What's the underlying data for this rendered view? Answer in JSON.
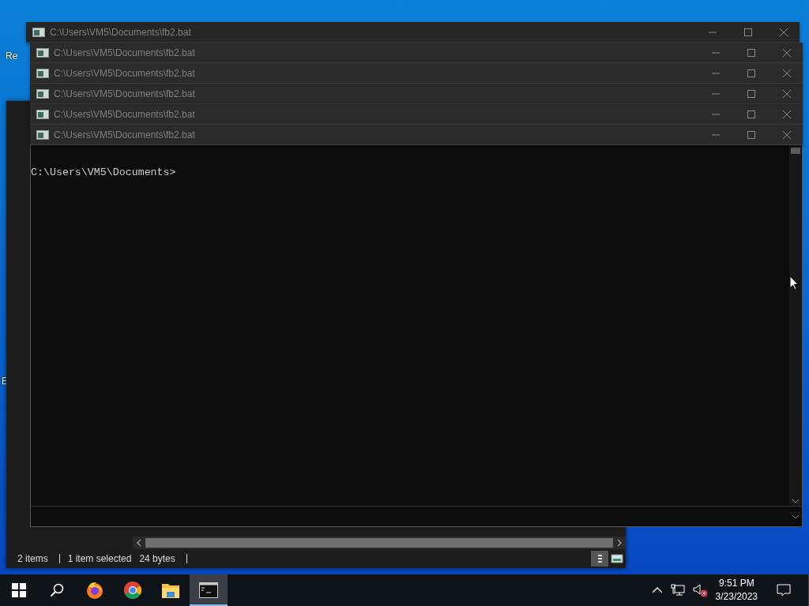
{
  "desktop": {
    "icon_labels": [
      "Re",
      "E"
    ]
  },
  "explorer": {
    "status_bar": [
      "2 items",
      "1 item selected",
      "24 bytes"
    ]
  },
  "console_windows": [
    {
      "title": "C:\\Users\\VM5\\Documents\\fb2.bat"
    },
    {
      "title": "C:\\Users\\VM5\\Documents\\fb2.bat"
    },
    {
      "title": "C:\\Users\\VM5\\Documents\\fb2.bat"
    },
    {
      "title": "C:\\Users\\VM5\\Documents\\fb2.bat"
    },
    {
      "title": "C:\\Users\\VM5\\Documents\\fb2.bat"
    },
    {
      "title": "C:\\Users\\VM5\\Documents\\fb2.bat"
    }
  ],
  "console": {
    "lines": [
      "C:\\Users\\VM5\\Documents>"
    ]
  },
  "taskbar": {
    "apps": [
      {
        "kind": "start",
        "selected": false
      },
      {
        "kind": "search",
        "selected": false
      },
      {
        "kind": "firefox",
        "selected": false
      },
      {
        "kind": "chrome",
        "selected": false
      },
      {
        "kind": "files",
        "selected": false
      },
      {
        "kind": "terminal",
        "selected": true
      }
    ],
    "tray": {
      "volume_muted": true,
      "time": "9:51 PM",
      "date": "3/23/2023"
    }
  }
}
